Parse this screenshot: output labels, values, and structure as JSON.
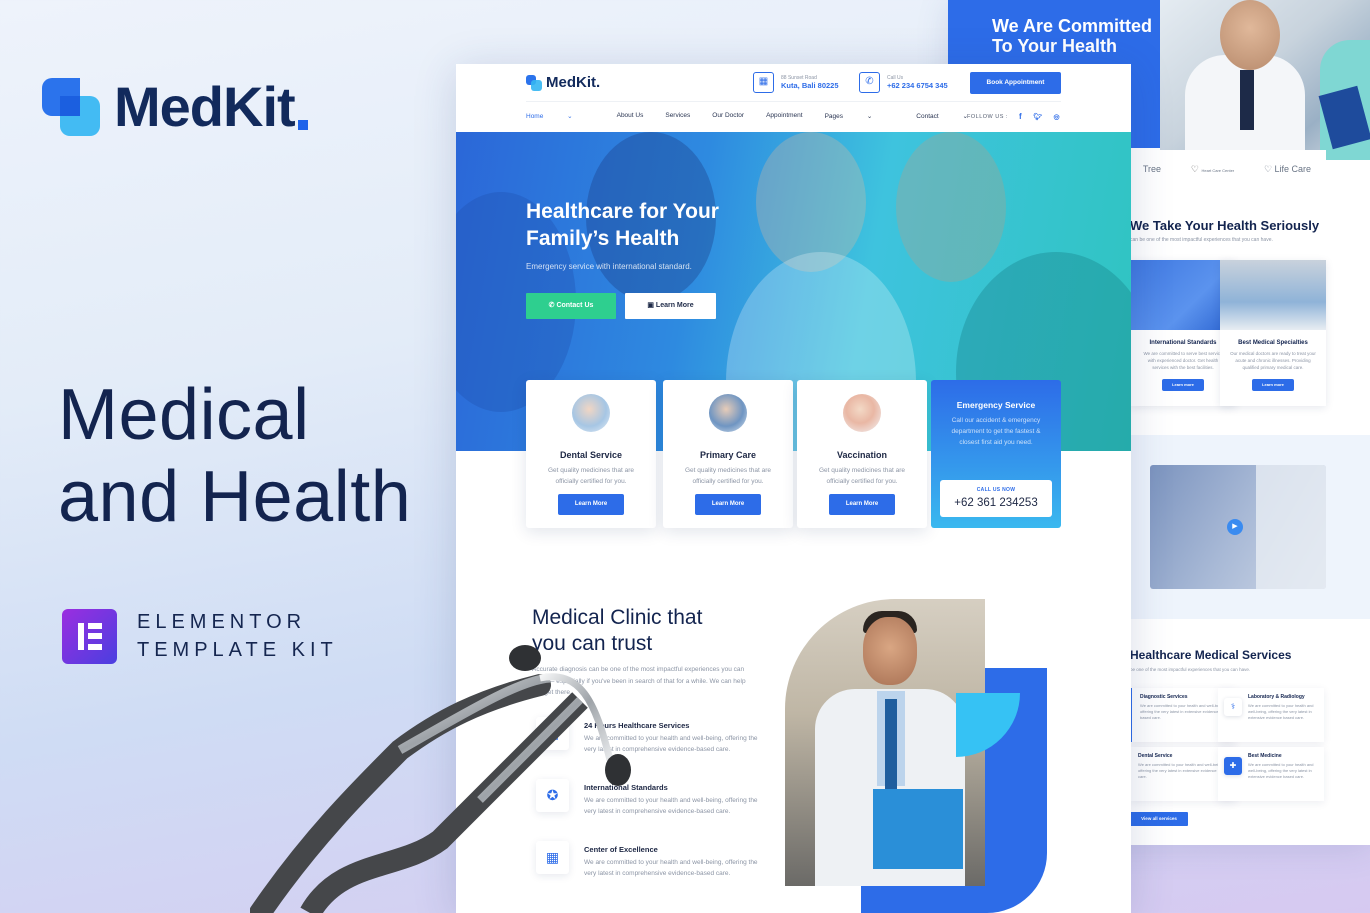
{
  "brand": {
    "name": "MedKit",
    "accent": "#2d6ce8"
  },
  "headline": {
    "line1": "Medical",
    "line2": "and Health"
  },
  "elementor": {
    "line1": "ELEMENTOR",
    "line2": "TEMPLATE KIT"
  },
  "main": {
    "logo": "MedKit.",
    "address": {
      "label": "88 Sunset Road",
      "value": "Kuta, Bali 80225",
      "icon": "building-icon"
    },
    "call": {
      "label": "Call Us",
      "value": "+62 234 6754 345",
      "icon": "phone-icon"
    },
    "book_button": "Book Appointment",
    "nav": [
      {
        "label": "Home",
        "dropdown": true,
        "active": true
      },
      {
        "label": "About Us"
      },
      {
        "label": "Services"
      },
      {
        "label": "Our Doctor"
      },
      {
        "label": "Appointment"
      },
      {
        "label": "Pages",
        "dropdown": true
      },
      {
        "label": "Contact",
        "dropdown": true
      }
    ],
    "follow_label": "FOLLOW US :",
    "social": [
      "facebook",
      "twitter",
      "instagram"
    ],
    "hero": {
      "title_line1": "Healthcare for Your",
      "title_line2": "Family’s Health",
      "subtitle": "Emergency service with international standard.",
      "contact_button": "Contact Us",
      "learn_button": "Learn More"
    },
    "service_cards": [
      {
        "title": "Dental Service",
        "desc": "Get quality medicines that are officially certified for you.",
        "button": "Learn More"
      },
      {
        "title": "Primary Care",
        "desc": "Get quality medicines that are officially certified for you.",
        "button": "Learn More"
      },
      {
        "title": "Vaccination",
        "desc": "Get quality medicines that are officially certified for you.",
        "button": "Learn More"
      }
    ],
    "emergency": {
      "title": "Emergency Service",
      "desc": "Call our accident & emergency department to get the fastest & closest first aid you need.",
      "call_label": "CALL US NOW",
      "phone": "+62 361 234253"
    },
    "clinic": {
      "title_line1": "Medical Clinic that",
      "title_line2": "you can trust",
      "desc": "Accurate diagnosis can be one of the most impactful experiences you can have — especially if you've been in search of that for a while. We can help you get there.",
      "features": [
        {
          "title": "24 Hours Healthcare Services",
          "desc": "We are committed to your health and well-being, offering the very latest in comprehensive evidence-based care."
        },
        {
          "title": "International Standards",
          "desc": "We are committed to your health and well-being, offering the very latest in comprehensive evidence-based care."
        },
        {
          "title": "Center of Excellence",
          "desc": "We are committed to your health and well-being, offering the very latest in comprehensive evidence-based care."
        }
      ]
    }
  },
  "back": {
    "hero_title_line1": "We Are Committed",
    "hero_title_line2": "To Your Health",
    "partners": [
      "Tree",
      "Heart Care Center",
      "Life Care"
    ],
    "section2": {
      "title": "We Take Your Health Seriously",
      "subtitle": "can be one of the most impactful experiences that you can have.",
      "cards": [
        {
          "title": "International Standards",
          "desc": "We are committed to serve best service with experienced doctor. Get health services with the best facilities.",
          "button": "Learn more"
        },
        {
          "title": "Best Medical Specialties",
          "desc": "Our medical doctors are ready to treat your acute and chronic illnesses. Providing qualified primary medical care.",
          "button": "Learn more"
        }
      ]
    },
    "section4": {
      "title": "Healthcare Medical Services",
      "subtitle": "be one of the most impactful experiences that you can have.",
      "services": [
        {
          "title": "Diagnostic Services",
          "desc": "We are committed to your health and well-being, offering the very latest in extensive evidence based care."
        },
        {
          "title": "Laboratory & Radiology",
          "desc": "We are committed to your health and well-being, offering the very latest in extensive evidence based care."
        },
        {
          "title": "Dental Service",
          "desc": "We are committed to your health and well-being, offering the very latest in extensive evidence based care."
        },
        {
          "title": "Best Medicine",
          "desc": "We are committed to your health and well-being, offering the very latest in extensive evidence based care."
        }
      ],
      "view_all": "View all services"
    }
  }
}
